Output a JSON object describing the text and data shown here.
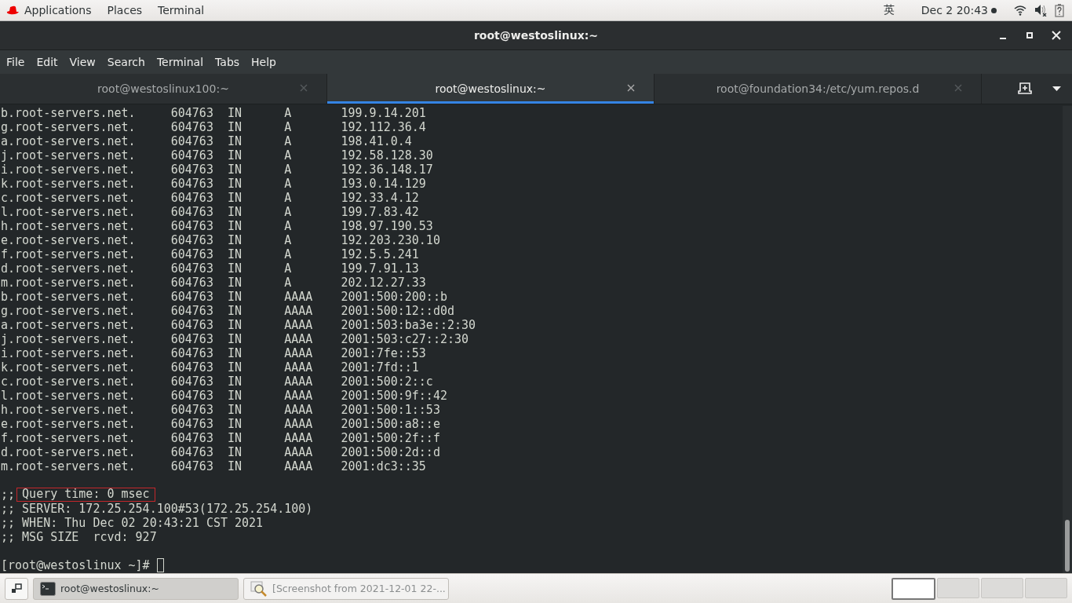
{
  "top_bar": {
    "menus": [
      "Applications",
      "Places",
      "Terminal"
    ],
    "input_method": "英",
    "clock": "Dec 2  20:43"
  },
  "window": {
    "title": "root@westoslinux:~",
    "menu": [
      "File",
      "Edit",
      "View",
      "Search",
      "Terminal",
      "Tabs",
      "Help"
    ],
    "tabs": [
      {
        "label": "root@westoslinux100:~",
        "selected": false
      },
      {
        "label": "root@westoslinux:~",
        "selected": true
      },
      {
        "label": "root@foundation34:/etc/yum.repos.d",
        "selected": false
      }
    ],
    "terminal": {
      "blocks": [
        {
          "lines": [
            {
              "text": "b.root-servers.net.     604763  IN      A       199.9.14.201",
              "highlighted": false
            },
            {
              "text": "g.root-servers.net.     604763  IN      A       192.112.36.4",
              "highlighted": false
            },
            {
              "text": "a.root-servers.net.     604763  IN      A       198.41.0.4",
              "highlighted": false
            },
            {
              "text": "j.root-servers.net.     604763  IN      A       192.58.128.30",
              "highlighted": false
            },
            {
              "text": "i.root-servers.net.     604763  IN      A       192.36.148.17",
              "highlighted": false
            },
            {
              "text": "k.root-servers.net.     604763  IN      A       193.0.14.129",
              "highlighted": false
            },
            {
              "text": "c.root-servers.net.     604763  IN      A       192.33.4.12",
              "highlighted": false
            },
            {
              "text": "l.root-servers.net.     604763  IN      A       199.7.83.42",
              "highlighted": false
            },
            {
              "text": "h.root-servers.net.     604763  IN      A       198.97.190.53",
              "highlighted": false
            },
            {
              "text": "e.root-servers.net.     604763  IN      A       192.203.230.10",
              "highlighted": false
            },
            {
              "text": "f.root-servers.net.     604763  IN      A       192.5.5.241",
              "highlighted": false
            },
            {
              "text": "d.root-servers.net.     604763  IN      A       199.7.91.13",
              "highlighted": false
            },
            {
              "text": "m.root-servers.net.     604763  IN      A       202.12.27.33",
              "highlighted": false
            },
            {
              "text": "b.root-servers.net.     604763  IN      AAAA    2001:500:200::b",
              "highlighted": false
            },
            {
              "text": "g.root-servers.net.     604763  IN      AAAA    2001:500:12::d0d",
              "highlighted": false
            },
            {
              "text": "a.root-servers.net.     604763  IN      AAAA    2001:503:ba3e::2:30",
              "highlighted": false
            },
            {
              "text": "j.root-servers.net.     604763  IN      AAAA    2001:503:c27::2:30",
              "highlighted": false
            },
            {
              "text": "i.root-servers.net.     604763  IN      AAAA    2001:7fe::53",
              "highlighted": false
            },
            {
              "text": "k.root-servers.net.     604763  IN      AAAA    2001:7fd::1",
              "highlighted": false
            },
            {
              "text": "c.root-servers.net.     604763  IN      AAAA    2001:500:2::c",
              "highlighted": false
            },
            {
              "text": "l.root-servers.net.     604763  IN      AAAA    2001:500:9f::42",
              "highlighted": false
            },
            {
              "text": "h.root-servers.net.     604763  IN      AAAA    2001:500:1::53",
              "highlighted": false
            },
            {
              "text": "e.root-servers.net.     604763  IN      AAAA    2001:500:a8::e",
              "highlighted": false
            },
            {
              "text": "f.root-servers.net.     604763  IN      AAAA    2001:500:2f::f",
              "highlighted": false
            },
            {
              "text": "d.root-servers.net.     604763  IN      AAAA    2001:500:2d::d",
              "highlighted": false
            },
            {
              "text": "m.root-servers.net.     604763  IN      AAAA    2001:dc3::35",
              "highlighted": false
            }
          ]
        },
        {
          "lines": [
            {
              "prefix": ";; ",
              "text": "Query time: 0 msec",
              "highlighted": true
            },
            {
              "text": ";; SERVER: 172.25.254.100#53(172.25.254.100)",
              "highlighted": false
            },
            {
              "text": ";; WHEN: Thu Dec 02 20:43:21 CST 2021",
              "highlighted": false
            },
            {
              "text": ";; MSG SIZE  rcvd: 927",
              "highlighted": false
            }
          ]
        }
      ],
      "prompt": "[root@westoslinux ~]#"
    }
  },
  "taskbar": {
    "windows": [
      {
        "label": "root@westoslinux:~",
        "selected": true,
        "kind": "terminal"
      },
      {
        "label": "[Screenshot from 2021-12-01 22-...",
        "selected": false,
        "kind": "viewer"
      }
    ],
    "workspaces": [
      {
        "selected": true
      },
      {
        "selected": false
      },
      {
        "selected": false
      },
      {
        "selected": false
      }
    ]
  }
}
